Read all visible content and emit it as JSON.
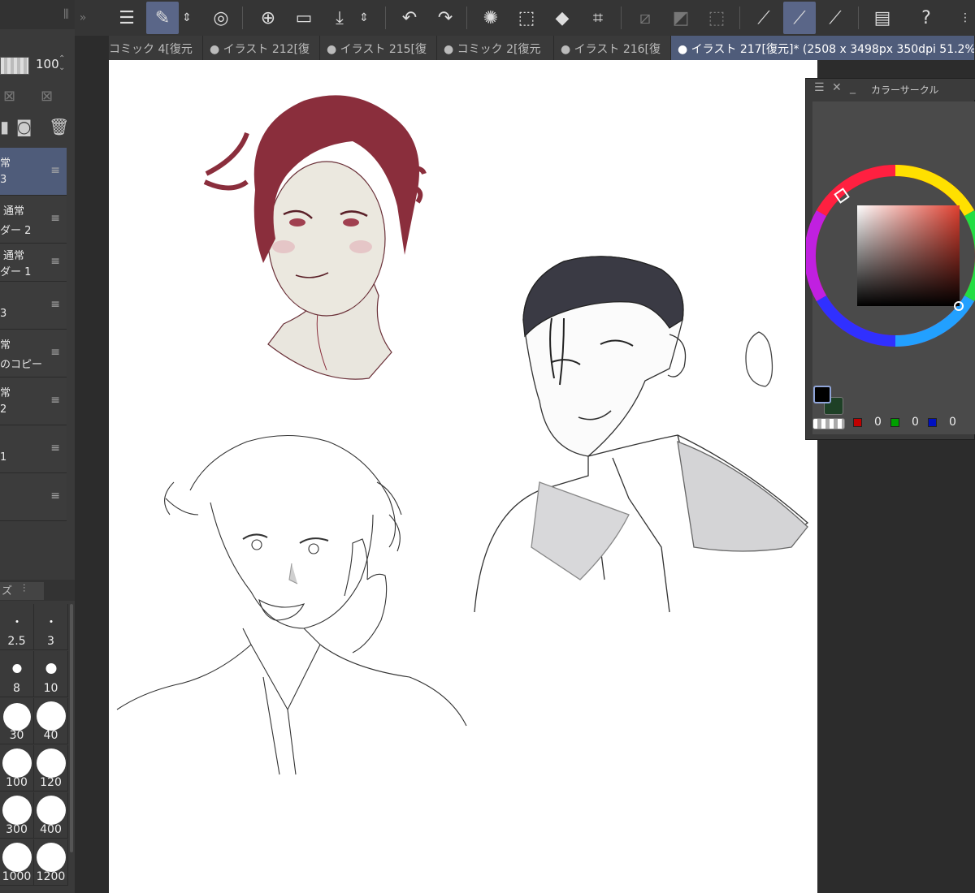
{
  "left_panel": {
    "opacity_value": "100",
    "layers": [
      {
        "line1": "常",
        "line2": "3",
        "selected": true
      },
      {
        "line1": "通常",
        "line2": "ダー 2",
        "selected": false
      },
      {
        "line1": "通常",
        "line2": "ダー 1",
        "selected": false
      },
      {
        "line1": "",
        "line2": "3",
        "selected": false
      },
      {
        "line1": "常",
        "line2": "のコピー",
        "selected": false
      },
      {
        "line1": "常",
        "line2": "2",
        "selected": false
      },
      {
        "line1": "",
        "line2": "1",
        "selected": false
      },
      {
        "line1": "",
        "line2": "",
        "selected": false
      }
    ],
    "brush_tab_label": "ズ",
    "brush_sizes": [
      "2.5",
      "3",
      "8",
      "10",
      "30",
      "40",
      "100",
      "120",
      "300",
      "400",
      "1000",
      "1200"
    ]
  },
  "tabs": [
    {
      "label": "コミック 4[復元",
      "active": false
    },
    {
      "label": "● イラスト 212[復",
      "active": false
    },
    {
      "label": "● イラスト 215[復",
      "active": false
    },
    {
      "label": "● コミック 2[復元",
      "active": false
    },
    {
      "label": "● イラスト 216[復",
      "active": false
    },
    {
      "label": "● イラスト 217[復元]* (2508 x 3498px 350dpi 51.2%",
      "active": true
    }
  ],
  "color_panel": {
    "title": "カラーサークル",
    "r": "0",
    "g": "0",
    "b": "0",
    "main_color": "#000000",
    "sub_color": "#1e4026"
  },
  "colors": {
    "accent": "#5a6688",
    "selected_layer": "#4f5c7a",
    "canvas": "#ffffff",
    "hair_red": "#8a2e3c"
  },
  "toolbar_icons": [
    "menu-icon",
    "eyedropper-tool-icon",
    "up-down-icon",
    "smudge-icon",
    "new-file-icon",
    "open-folder-icon",
    "save-icon",
    "up-down-icon",
    "undo-icon",
    "redo-icon",
    "loading-icon",
    "select-icon",
    "fill-icon",
    "transform-icon",
    "clear-selection-icon",
    "invert-icon",
    "select-all-icon",
    "pen-icon",
    "brush-icon",
    "eraser-icon",
    "layout-icon",
    "help-icon"
  ]
}
